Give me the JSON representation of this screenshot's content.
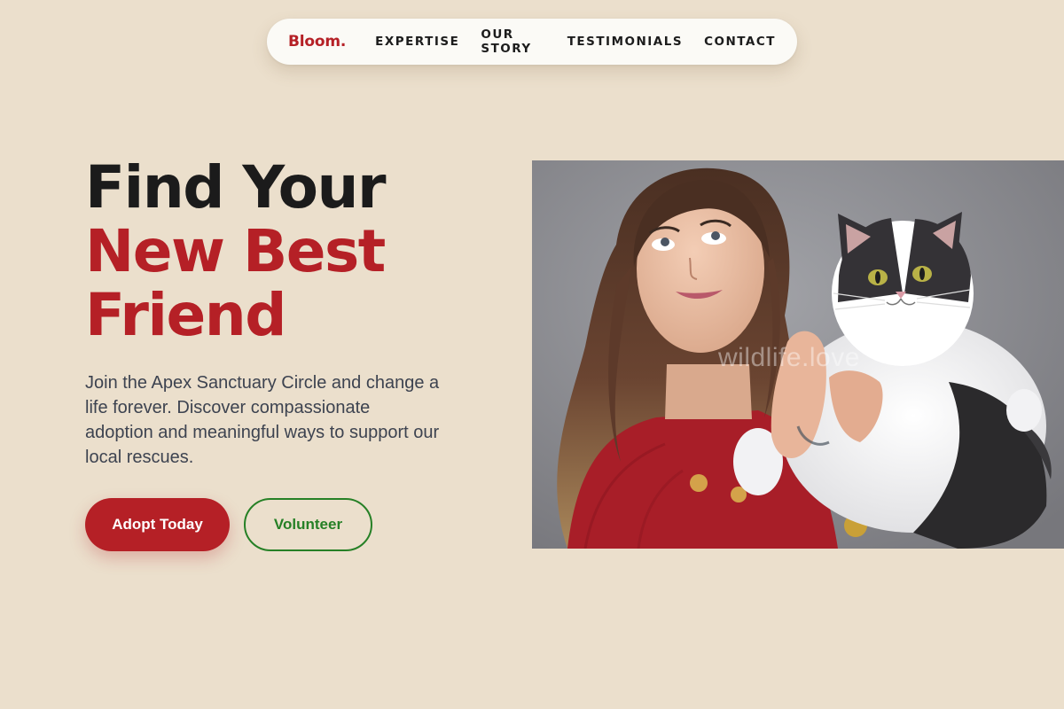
{
  "nav": {
    "brand": "Bloom.",
    "links": [
      "EXPERTISE",
      "OUR STORY",
      "TESTIMONIALS",
      "CONTACT"
    ]
  },
  "hero": {
    "title_line1": "Find Your",
    "title_line2": "New Best",
    "title_line3": "Friend",
    "description": "Join the Apex Sanctuary Circle and change a life forever. Discover compassionate adoption and meaningful ways to support our local rescues.",
    "primary_button": "Adopt Today",
    "secondary_button": "Volunteer",
    "image_watermark": "wildlife.love"
  },
  "colors": {
    "background": "#ebdfcc",
    "brand_red": "#b52026",
    "volunteer_green": "#268026",
    "heading_dark": "#1b1b1b",
    "body_text": "#3d4350",
    "nav_background": "#fbfaf6"
  }
}
